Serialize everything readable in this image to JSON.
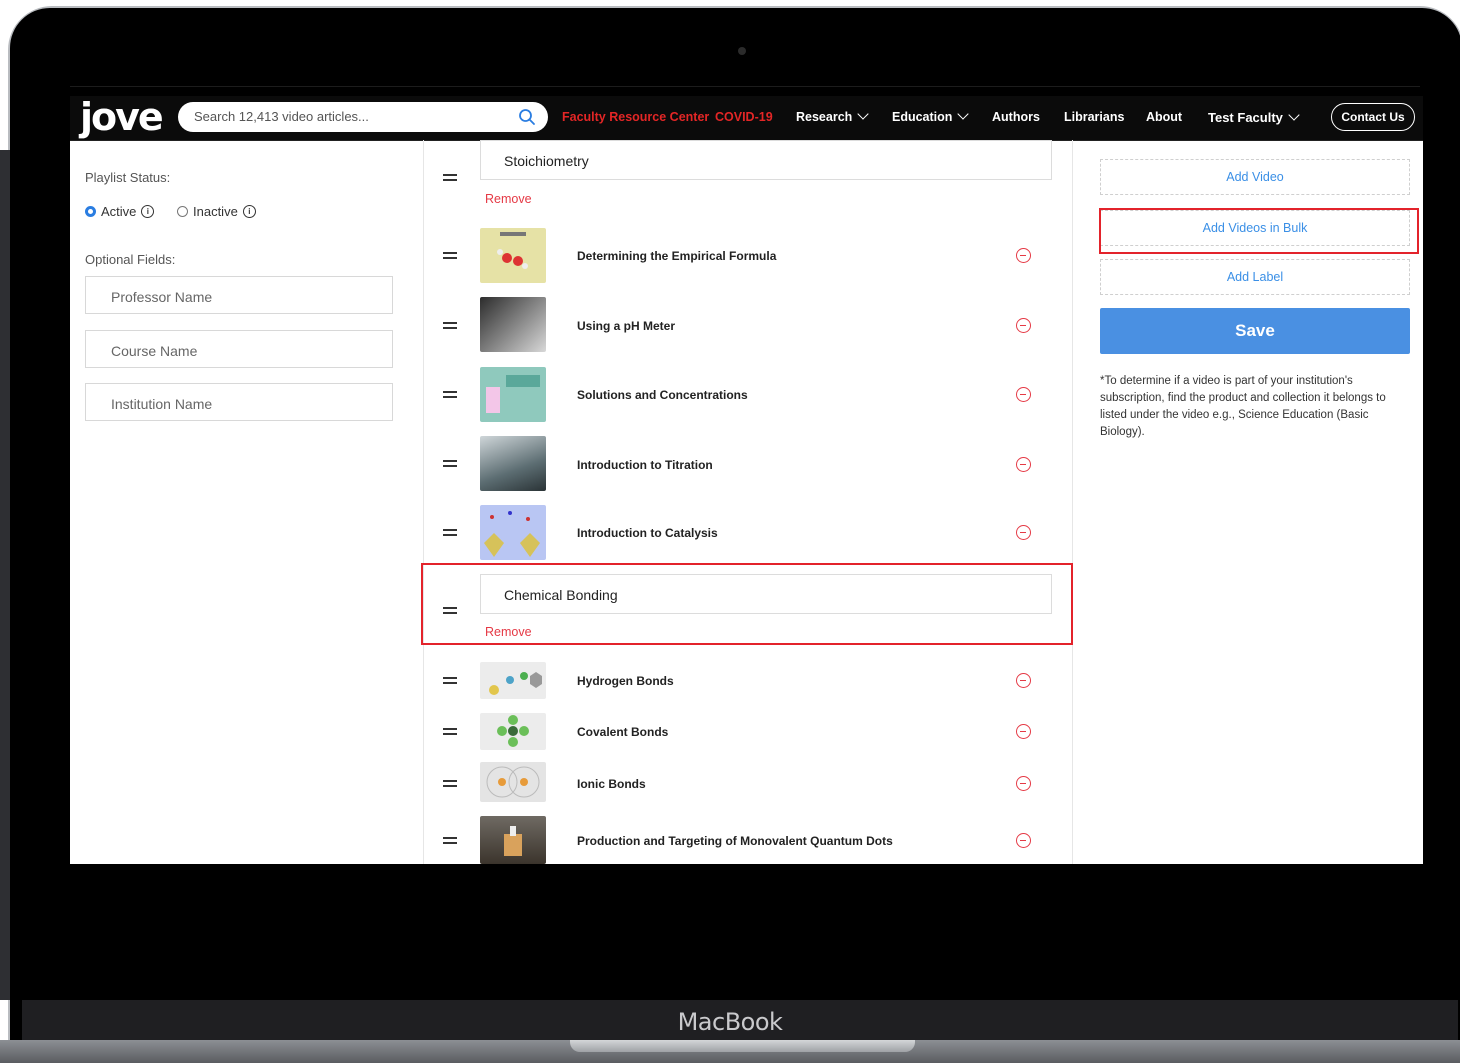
{
  "device": {
    "label": "MacBook"
  },
  "nav": {
    "logo": "jove",
    "search_placeholder": "Search 12,413 video articles...",
    "items": [
      {
        "label": "Faculty Resource Center"
      },
      {
        "label": "COVID-19"
      },
      {
        "label": "Research"
      },
      {
        "label": "Education"
      },
      {
        "label": "Authors"
      },
      {
        "label": "Librarians"
      },
      {
        "label": "About"
      },
      {
        "label": "Test Faculty"
      }
    ],
    "contact": "Contact Us"
  },
  "left": {
    "status_label": "Playlist Status:",
    "active_label": "Active",
    "inactive_label": "Inactive",
    "info_glyph": "i",
    "optional_label": "Optional Fields:",
    "professor_placeholder": "Professor Name",
    "course_placeholder": "Course Name",
    "institution_placeholder": "Institution Name"
  },
  "playlist": {
    "sections": [
      {
        "title": "Stoichiometry",
        "remove": "Remove"
      },
      {
        "title": "Chemical Bonding",
        "remove": "Remove"
      }
    ],
    "videos": [
      {
        "title": "Determining the Empirical Formula"
      },
      {
        "title": "Using a pH Meter"
      },
      {
        "title": "Solutions and Concentrations"
      },
      {
        "title": "Introduction to Titration"
      },
      {
        "title": "Introduction to Catalysis"
      },
      {
        "title": "Hydrogen Bonds"
      },
      {
        "title": "Covalent Bonds"
      },
      {
        "title": "Ionic Bonds"
      },
      {
        "title": "Production and Targeting of Monovalent Quantum Dots"
      }
    ]
  },
  "right": {
    "add_video": "Add Video",
    "add_bulk": "Add Videos in Bulk",
    "add_label": "Add Label",
    "save": "Save",
    "note": "*To determine if a video is part of your institution's subscription, find the product and collection it belongs to listed under the video e.g., Science Education (Basic Biology)."
  },
  "colors": {
    "accent": "#4a90e2",
    "remove": "#e53945",
    "highlight": "#e3232b",
    "nav_red": "#e32626"
  }
}
